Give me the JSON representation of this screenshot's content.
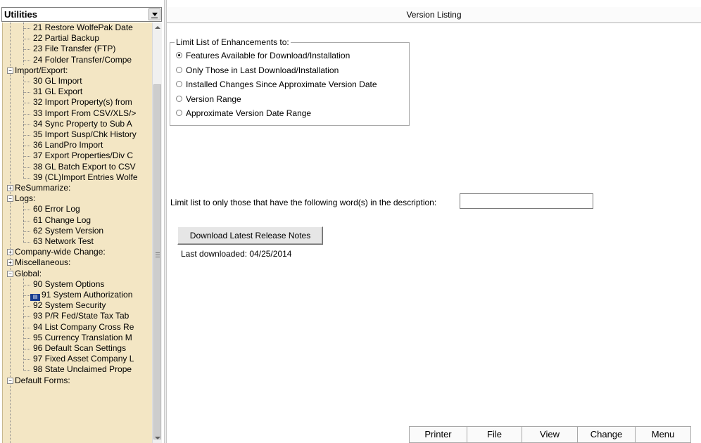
{
  "sidebar": {
    "module_select": {
      "value": "Utilities"
    },
    "tree": [
      {
        "kind": "leaf",
        "label": "21 Restore WolfePak Date"
      },
      {
        "kind": "leaf",
        "label": "22 Partial Backup"
      },
      {
        "kind": "leaf",
        "label": "23 File Transfer (FTP)"
      },
      {
        "kind": "leaf",
        "label": "24 Folder Transfer/Compe"
      },
      {
        "kind": "group",
        "label": "Import/Export:",
        "expanded": true
      },
      {
        "kind": "leaf",
        "label": "30 GL Import"
      },
      {
        "kind": "leaf",
        "label": "31 GL Export"
      },
      {
        "kind": "leaf",
        "label": "32 Import Property(s) from"
      },
      {
        "kind": "leaf",
        "label": "33 Import From CSV/XLS/>"
      },
      {
        "kind": "leaf",
        "label": "34 Sync Property to Sub A"
      },
      {
        "kind": "leaf",
        "label": "35 Import Susp/Chk History"
      },
      {
        "kind": "leaf",
        "label": "36 LandPro Import"
      },
      {
        "kind": "leaf",
        "label": "37 Export Properties/Div C"
      },
      {
        "kind": "leaf",
        "label": "38 GL Batch Export to CSV"
      },
      {
        "kind": "leaf",
        "label": "39 (CL)Import Entries Wolfe"
      },
      {
        "kind": "group",
        "label": "ReSummarize:",
        "expanded": false
      },
      {
        "kind": "group",
        "label": "Logs:",
        "expanded": true
      },
      {
        "kind": "leaf",
        "label": "60 Error Log"
      },
      {
        "kind": "leaf",
        "label": "61 Change Log"
      },
      {
        "kind": "leaf",
        "label": "62 System Version"
      },
      {
        "kind": "leaf",
        "label": "63 Network Test"
      },
      {
        "kind": "group",
        "label": "Company-wide Change:",
        "expanded": false
      },
      {
        "kind": "group",
        "label": "Miscellaneous:",
        "expanded": false
      },
      {
        "kind": "group",
        "label": "Global:",
        "expanded": true
      },
      {
        "kind": "leaf",
        "label": "90 System Options"
      },
      {
        "kind": "leaf",
        "label": "91 System Authorization",
        "icon": "authorization-icon"
      },
      {
        "kind": "leaf",
        "label": "92 System Security"
      },
      {
        "kind": "leaf",
        "label": "93 P/R Fed/State Tax Tab"
      },
      {
        "kind": "leaf",
        "label": "94 List Company Cross Re"
      },
      {
        "kind": "leaf",
        "label": "95 Currency Translation M"
      },
      {
        "kind": "leaf",
        "label": "96 Default Scan Settings"
      },
      {
        "kind": "leaf",
        "label": "97 Fixed Asset Company L"
      },
      {
        "kind": "leaf",
        "label": "98 State Unclaimed Prope"
      },
      {
        "kind": "group",
        "label": "Default Forms:",
        "expanded": true
      }
    ]
  },
  "main": {
    "title": "Version Listing",
    "filter_group": {
      "legend": "Limit List of Enhancements to:",
      "options": [
        {
          "label": "Features Available for Download/Installation",
          "selected": true
        },
        {
          "label": "Only Those in Last Download/Installation",
          "selected": false
        },
        {
          "label": "Installed Changes Since Approximate Version Date",
          "selected": false
        },
        {
          "label": "Version Range",
          "selected": false
        },
        {
          "label": "Approximate Version Date Range",
          "selected": false
        }
      ]
    },
    "keyword_filter": {
      "label": "Limit list to only those that have the following word(s) in the description:",
      "value": ""
    },
    "download_button": "Download Latest Release Notes",
    "last_downloaded": "Last downloaded: 04/25/2014",
    "menubar": [
      "Printer",
      "File",
      "View",
      "Change",
      "Menu"
    ]
  },
  "colors": {
    "tree_background": "#f3e6c4",
    "panel_background": "#ffffff",
    "button_face": "#e6e6e6"
  }
}
